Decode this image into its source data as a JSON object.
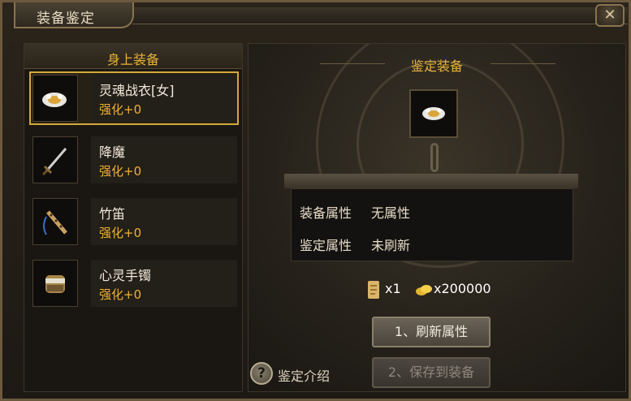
{
  "window": {
    "title": "装备鉴定",
    "close_symbol": "✕"
  },
  "left_panel": {
    "header": "身上装备",
    "items": [
      {
        "name": "灵魂战衣[女]",
        "level": "强化+0",
        "icon": "armor-icon",
        "selected": true
      },
      {
        "name": "降魔",
        "level": "强化+0",
        "icon": "sword-icon",
        "selected": false
      },
      {
        "name": "竹笛",
        "level": "强化+0",
        "icon": "flute-icon",
        "selected": false
      },
      {
        "name": "心灵手镯",
        "level": "强化+0",
        "icon": "bracelet-icon",
        "selected": false
      }
    ]
  },
  "right_panel": {
    "section_title": "鉴定装备",
    "slot_icon": "armor-icon",
    "attributes": [
      {
        "label": "装备属性",
        "value": "无属性"
      },
      {
        "label": "鉴定属性",
        "value": "未刷新"
      }
    ],
    "costs": {
      "scroll_count": "x1",
      "gold_count": "x200000"
    },
    "buttons": {
      "refresh": "1、刷新属性",
      "save": "2、保存到装备"
    },
    "help_icon_symbol": "?",
    "help_text": "鉴定介绍"
  },
  "colors": {
    "accent": "#e9b23a",
    "level_text": "#f0b134",
    "selected_border": "#d4a83c"
  }
}
